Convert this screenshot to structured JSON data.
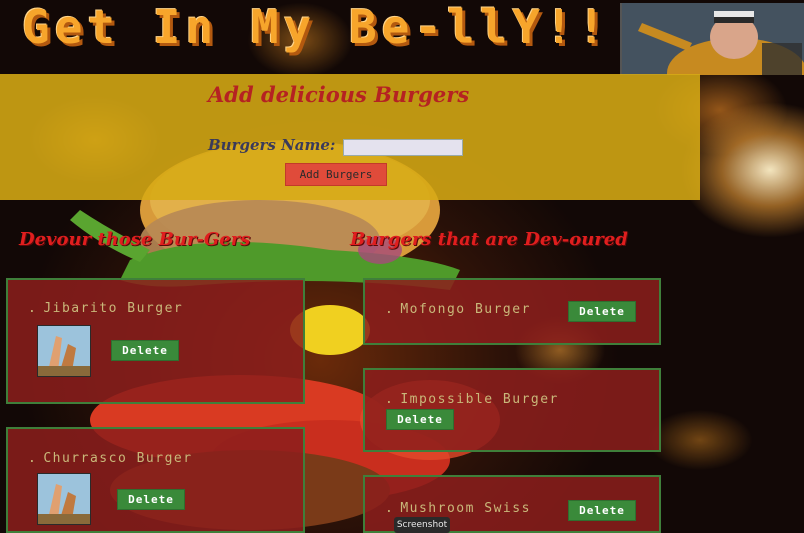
{
  "header": {
    "title": "Get In My Be-llY!!"
  },
  "form": {
    "heading": "Add delicious Burgers",
    "name_label": "Burgers Name:",
    "name_value": "",
    "submit_label": "Add Burgers"
  },
  "columns": {
    "devour_title": "Devour those Bur-Gers",
    "devoured_title": "Burgers that are Dev-oured"
  },
  "to_devour": [
    {
      "name": "Jibarito Burger",
      "delete_label": "Delete"
    },
    {
      "name": "Churrasco Burger",
      "delete_label": "Delete"
    }
  ],
  "devoured": [
    {
      "name": "Mofongo Burger",
      "delete_label": "Delete"
    },
    {
      "name": "Impossible Burger",
      "delete_label": "Delete"
    },
    {
      "name": "Mushroom Swiss",
      "delete_label": "Delete"
    }
  ],
  "tooltip": "Screenshot",
  "colors": {
    "title_orange": "#f7a52b",
    "panel_gold": "#d6aa14",
    "heading_red": "#b52222",
    "section_red": "#e01e1e",
    "card_red": "#8c1e1c",
    "card_border_green": "#3f7f3a",
    "delete_green": "#3a8a3a",
    "add_button_red": "#e04b3a",
    "item_text": "#c9b87a"
  },
  "icons": [
    "bullet-dot",
    "burger-thumbnail",
    "chef-photo",
    "burger-background"
  ]
}
